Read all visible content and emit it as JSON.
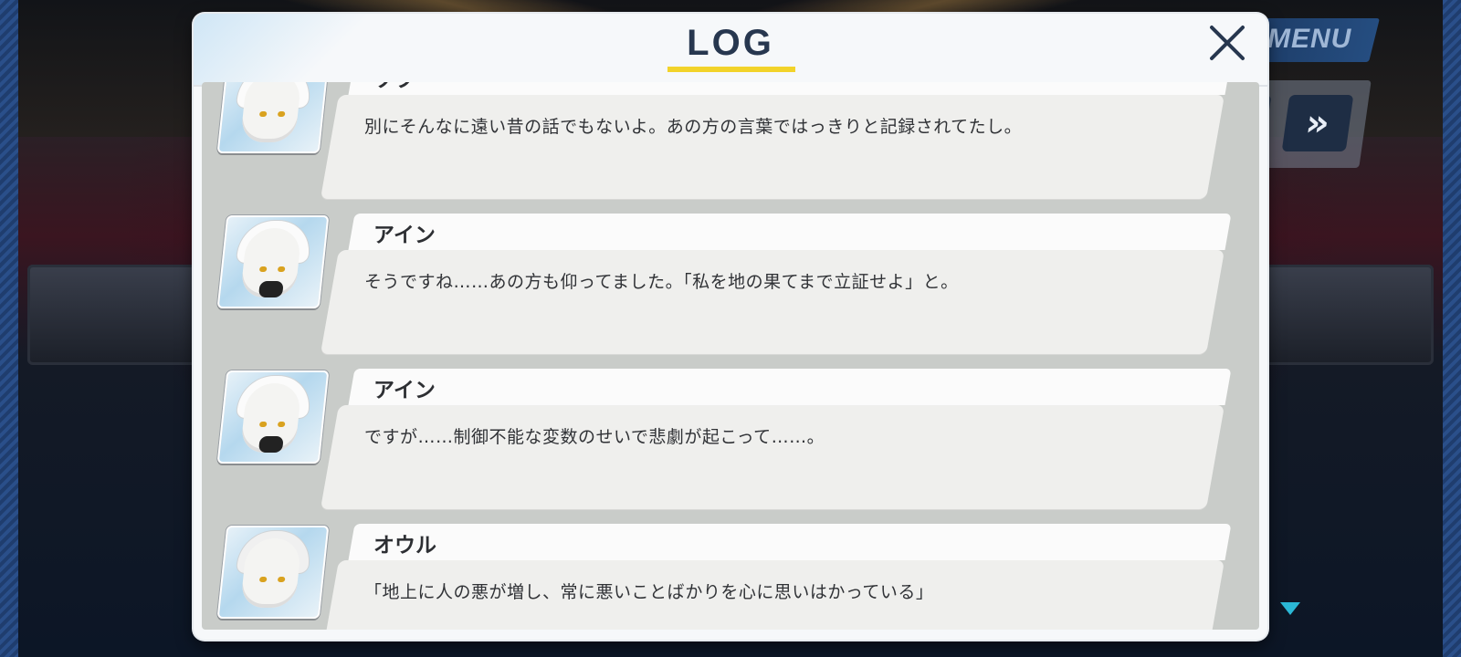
{
  "dialog": {
    "title": "LOG",
    "close_icon": "close-icon"
  },
  "hud": {
    "menu_label": "MENU",
    "fast_forward_icon": "fast-forward-icon",
    "fast_forward_glyph": "»"
  },
  "log": {
    "entries": [
      {
        "speaker": "ソフ",
        "text": "別にそんなに遠い昔の話でもないよ。あの方の言葉ではっきりと記録されてたし。"
      },
      {
        "speaker": "アイン",
        "text": "そうですね……あの方も仰ってました。「私を地の果てまで立証せよ」と。"
      },
      {
        "speaker": "アイン",
        "text": "ですが……制御不能な変数のせいで悲劇が起こって……。"
      },
      {
        "speaker": "オウル",
        "text": "「地上に人の悪が増し、常に悪いことばかりを心に思いはかっている」"
      }
    ]
  },
  "colors": {
    "title": "#27374f",
    "underline": "#f2d32a",
    "accent": "#2bb8d6"
  }
}
